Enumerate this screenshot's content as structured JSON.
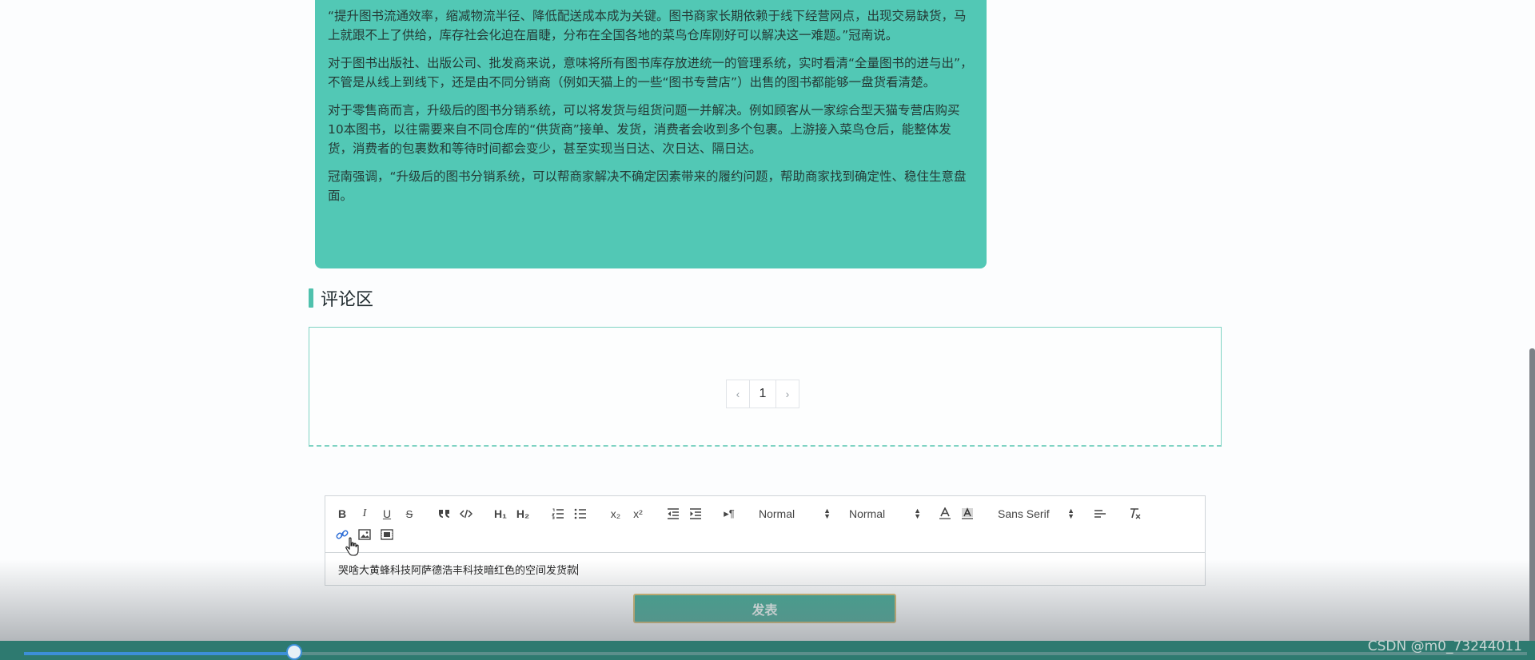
{
  "article": {
    "paragraphs": [
      "“提升图书流通效率，缩减物流半径、降低配送成本成为关键。图书商家长期依赖于线下经营网点，出现交易缺货，马上就跟不上了供给，库存社会化迫在眉睫，分布在全国各地的菜鸟仓库刚好可以解决这一难题。”冠南说。",
      "对于图书出版社、出版公司、批发商来说，意味将所有图书库存放进统一的管理系统，实时看清“全量图书的进与出”，不管是从线上到线下，还是由不同分销商（例如天猫上的一些“图书专营店”）出售的图书都能够一盘货看清楚。",
      "对于零售商而言，升级后的图书分销系统，可以将发货与组货问题一并解决。例如顾客从一家综合型天猫专营店购买10本图书，以往需要来自不同仓库的“供货商”接单、发货，消费者会收到多个包裹。上游接入菜鸟仓后，能整体发货，消费者的包裹数和等待时间都会变少，甚至实现当日达、次日达、隔日达。",
      "冠南强调，“升级后的图书分销系统，可以帮商家解决不确定因素带来的履约问题，帮助商家找到确定性、稳住生意盘面。"
    ]
  },
  "comments": {
    "title": "评论区",
    "pagination": {
      "prev": "‹",
      "current": "1",
      "next": "›"
    }
  },
  "editor": {
    "header_picker": "Normal",
    "size_picker": "Normal",
    "font_picker": "Sans Serif",
    "content": "哭啥大黄蜂科技阿萨德浩丰科技暗红色的空间发货款",
    "toolbar_glyphs": {
      "bold": "B",
      "italic": "I",
      "underline": "U",
      "strike": "S",
      "h1": "H₁",
      "h2": "H₂",
      "sub": "x₂",
      "sup": "x²",
      "rtl": "▸¶",
      "clean": "T̶ₓ"
    }
  },
  "publish_button": "发表",
  "video": {
    "progress": 0.18
  },
  "watermark": "CSDN @m0_73244011",
  "colors": {
    "accent": "#52c8b5",
    "button": "#3aa590",
    "progress": "#3d8fd8"
  }
}
